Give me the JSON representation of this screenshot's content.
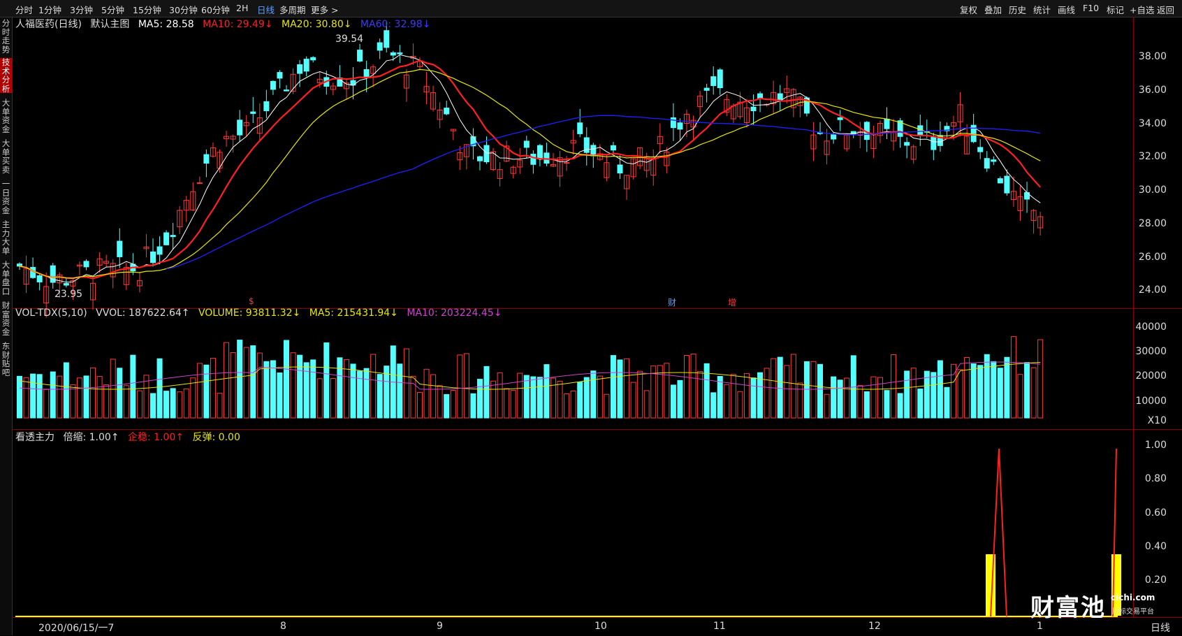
{
  "timeframes": [
    "分时",
    "1分钟",
    "3分钟",
    "5分钟",
    "15分钟",
    "30分钟",
    "60分钟",
    "2H",
    "日线",
    "多周期",
    "更多 >"
  ],
  "active_timeframe": "日线",
  "right_menu": [
    "复权",
    "叠加",
    "历史",
    "统计",
    "画线",
    "F10",
    "标记",
    "+自选",
    "返回"
  ],
  "sidebar_tabs": [
    "分时走势",
    "技术分析",
    "大单资金",
    "大单买卖",
    "一日资金",
    "主力大单",
    "大单盘口",
    "财富资金",
    "东财贴吧"
  ],
  "active_sidebar": "技术分析",
  "main_legend": {
    "stock": "人福医药(日线)",
    "template": "默认主图",
    "ma5": "MA5: 28.58",
    "ma10": "MA10: 29.49↓",
    "ma20": "MA20: 30.80↓",
    "ma60": "MA60: 32.98↓"
  },
  "price_axis": [
    "38.00",
    "36.00",
    "34.00",
    "32.00",
    "30.00",
    "28.00",
    "26.00",
    "24.00"
  ],
  "high_label": "39.54",
  "low_label": "23.95",
  "markers": {
    "s": "$",
    "cai": "财",
    "zeng": "增"
  },
  "volume_legend": {
    "name": "VOL-TDX(5,10)",
    "vvol": "VVOL: 187622.64↑",
    "volume": "VOLUME: 93811.32↓",
    "ma5": "MA5: 215431.94↓",
    "ma10": "MA10: 203224.45↓"
  },
  "volume_axis": [
    "40000",
    "30000",
    "20000",
    "10000",
    "X10"
  ],
  "indicator_legend": {
    "name": "看透主力",
    "scale": "倍缩: 1.00↑",
    "qiwen": "企稳: 1.00↑",
    "fantan": "反弹: 0.00"
  },
  "indicator_axis": [
    "1.00",
    "0.80",
    "0.60",
    "0.40",
    "0.20"
  ],
  "x_axis": {
    "start": "2020/06/15/一7",
    "months": [
      "8",
      "9",
      "10",
      "11",
      "12",
      "1"
    ],
    "period": "日线"
  },
  "watermark": {
    "main": "财富池",
    "url": "cichi.com",
    "sub": "股标交易平台"
  },
  "colors": {
    "up": "#ff3b3b",
    "down": "#54ffff",
    "ma5": "#ffffff",
    "ma10": "#ff2020",
    "ma20": "#e6e600",
    "ma60": "#2020ff",
    "vol_ma5": "#e6e600",
    "vol_ma10": "#cc44cc",
    "indicator": "#ffff00"
  }
}
